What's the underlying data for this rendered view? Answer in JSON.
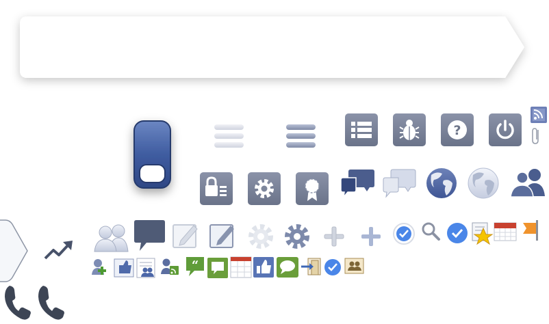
{
  "sheet": {
    "type": "icon-sprite-sheet",
    "background": "#ffffff"
  },
  "colors": {
    "brand_dark": "#3b5998",
    "slate": "#6d7894",
    "slate_light": "#9aa3b8",
    "light_blue": "#a8b5d6",
    "blue_check": "#4a86e8",
    "green": "#6a9e3a",
    "red": "#c8412f",
    "orange": "#f0932c",
    "gold": "#f5c400",
    "phone_dark": "#3d4555"
  },
  "icons": [
    "tooltip-bubble",
    "toggle-switch",
    "hamburger-light-icon",
    "hamburger-dark-icon",
    "list-icon",
    "bug-icon",
    "help-icon",
    "power-icon",
    "rss-icon",
    "paperclip-icon",
    "lock-list-icon",
    "gear-icon",
    "badge-icon",
    "chat-dark-icon",
    "chat-light-icon",
    "globe-dark-icon",
    "globe-light-icon",
    "people-dark-icon",
    "arrow-tab",
    "trend-icon",
    "people-light-icon",
    "comment-icon",
    "edit-light-icon",
    "edit-dark-icon",
    "gear-light-icon",
    "gear-blue-icon",
    "plus-light-icon",
    "plus-blue-icon",
    "verified-outline-icon",
    "search-icon",
    "verified-icon",
    "favorite-page-icon",
    "calendar-icon",
    "flag-icon",
    "add-friend-icon",
    "like-page-icon",
    "notes-people-icon",
    "subscribe-icon",
    "quote-icon",
    "speech-green-icon",
    "calendar-grid-icon",
    "thumbs-up-icon",
    "speech-bubble-green-icon",
    "enter-door-icon",
    "check-small-icon",
    "contact-card-icon",
    "phone-dark-icon",
    "phone-outline-icon"
  ]
}
